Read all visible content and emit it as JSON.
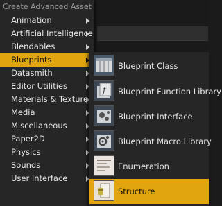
{
  "menu": {
    "header": "Create Advanced Asset",
    "items": [
      {
        "label": "Animation",
        "has_submenu": true
      },
      {
        "label": "Artificial Intelligence",
        "has_submenu": true
      },
      {
        "label": "Blendables",
        "has_submenu": true
      },
      {
        "label": "Blueprints",
        "has_submenu": true,
        "active": true
      },
      {
        "label": "Datasmith",
        "has_submenu": true
      },
      {
        "label": "Editor Utilities",
        "has_submenu": true
      },
      {
        "label": "Materials & Textures",
        "has_submenu": true
      },
      {
        "label": "Media",
        "has_submenu": true
      },
      {
        "label": "Miscellaneous",
        "has_submenu": true
      },
      {
        "label": "Paper2D",
        "has_submenu": true
      },
      {
        "label": "Physics",
        "has_submenu": true
      },
      {
        "label": "Sounds",
        "has_submenu": true
      },
      {
        "label": "User Interface",
        "has_submenu": true
      }
    ]
  },
  "submenu": {
    "items": [
      {
        "label": "Blueprint Class",
        "icon": "blueprint-class-icon"
      },
      {
        "label": "Blueprint Function Library",
        "icon": "blueprint-function-library-icon"
      },
      {
        "label": "Blueprint Interface",
        "icon": "blueprint-interface-icon"
      },
      {
        "label": "Blueprint Macro Library",
        "icon": "blueprint-macro-library-icon"
      },
      {
        "label": "Enumeration",
        "icon": "enumeration-icon"
      },
      {
        "label": "Structure",
        "icon": "structure-icon",
        "active": true
      }
    ]
  },
  "colors": {
    "highlight": "#e0a50f",
    "menu_bg": "#262626",
    "text": "#e6e6e6"
  }
}
